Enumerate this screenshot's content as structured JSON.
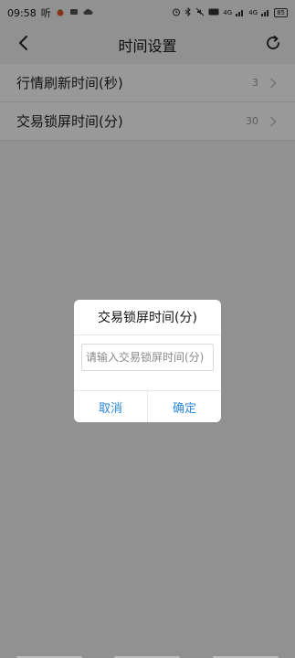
{
  "status_bar": {
    "time": "09:58",
    "extra_text": "听",
    "network_1": "4G",
    "network_2": "4G",
    "battery": "85"
  },
  "header": {
    "title": "时间设置",
    "back_icon": "chevron-left-icon",
    "refresh_icon": "refresh-icon"
  },
  "settings": {
    "items": [
      {
        "label": "行情刷新时间(秒)",
        "value": "3"
      },
      {
        "label": "交易锁屏时间(分)",
        "value": "30"
      }
    ]
  },
  "dialog": {
    "title": "交易锁屏时间(分)",
    "input_placeholder": "请输入交易锁屏时间(分)",
    "cancel_label": "取消",
    "confirm_label": "确定",
    "button_color": "#2a86d8"
  }
}
